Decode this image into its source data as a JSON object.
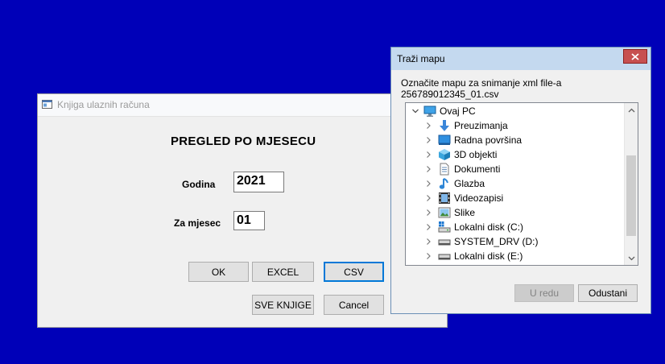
{
  "left_window": {
    "title": "Knjiga ulaznih računa",
    "heading": "PREGLED PO MJESECU",
    "year_label": "Godina",
    "year_value": "2021",
    "month_label": "Za mjesec",
    "month_value": "01",
    "buttons": {
      "ok": "OK",
      "excel": "EXCEL",
      "csv": "CSV",
      "sve_knjige": "SVE KNJIGE",
      "cancel": "Cancel"
    }
  },
  "folder_dialog": {
    "title": "Traži mapu",
    "instruction": "Označite mapu za snimanje xml file-a 256789012345_01.csv",
    "tree": {
      "root": {
        "label": "Ovaj PC",
        "icon": "computer-icon"
      },
      "items": [
        {
          "label": "Preuzimanja",
          "icon": "download-icon"
        },
        {
          "label": "Radna površina",
          "icon": "desktop-icon"
        },
        {
          "label": "3D objekti",
          "icon": "cube-icon"
        },
        {
          "label": "Dokumenti",
          "icon": "document-icon"
        },
        {
          "label": "Glazba",
          "icon": "music-icon"
        },
        {
          "label": "Videozapisi",
          "icon": "video-icon"
        },
        {
          "label": "Slike",
          "icon": "picture-icon"
        },
        {
          "label": "Lokalni disk (C:)",
          "icon": "system-drive-icon"
        },
        {
          "label": "SYSTEM_DRV (D:)",
          "icon": "drive-icon"
        },
        {
          "label": "Lokalni disk (E:)",
          "icon": "drive-icon"
        }
      ]
    },
    "buttons": {
      "ok": "U redu",
      "cancel": "Odustani"
    }
  },
  "colors": {
    "desktop_background": "#0000b8",
    "dialog_titlebar": "#c4d9ef",
    "close_button": "#c75050",
    "default_button_border": "#0078d7"
  }
}
